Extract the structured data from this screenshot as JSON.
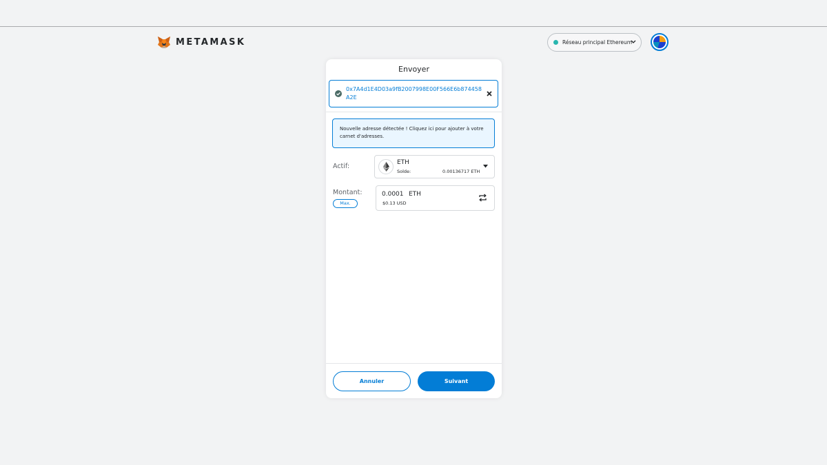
{
  "header": {
    "brand": "METAMASK",
    "logo_icon": "metamask-fox-icon",
    "network_label": "Réseau principal Ethereum",
    "network_status_color": "#29b6af"
  },
  "send": {
    "title": "Envoyer",
    "recipient_address": "0x7A4d1E4D03a9fB2007998E00F566E6b874458A2E",
    "new_address_notice": "Nouvelle adresse détectée ! Cliquez ici pour ajouter à votre carnet d'adresses.",
    "asset_label": "Actif:",
    "asset_symbol": "ETH",
    "balance_label": "Solde:",
    "balance_value": "0.00136717 ETH",
    "amount_label": "Montant:",
    "max_label": "Max.",
    "amount_value": "0.0001",
    "amount_unit": "ETH",
    "amount_fiat": "$0.13 USD",
    "cancel_label": "Annuler",
    "next_label": "Suivant"
  },
  "colors": {
    "accent": "#037dd6",
    "background": "#f2f3f4"
  }
}
